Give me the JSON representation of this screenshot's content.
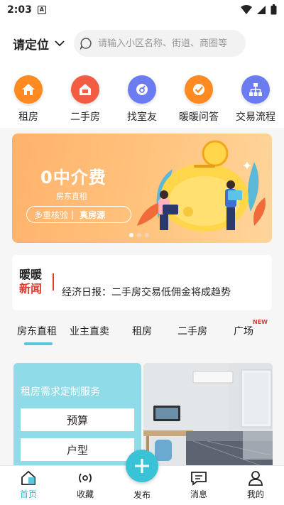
{
  "status_bar": {
    "time": "2:03",
    "a_label": "A"
  },
  "header": {
    "location_label": "请定位",
    "search_placeholder": "请输入小区名称、街道、商圈等"
  },
  "categories": [
    {
      "label": "租房",
      "icon": "house-icon",
      "color": "#ff8a22"
    },
    {
      "label": "二手房",
      "icon": "second-hand-house-icon",
      "color": "#f25c42"
    },
    {
      "label": "找室友",
      "icon": "roommate-icon",
      "color": "#6a7cf0"
    },
    {
      "label": "暖暖问答",
      "icon": "check-qa-icon",
      "color": "#ff8a22"
    },
    {
      "label": "交易流程",
      "icon": "flow-chart-icon",
      "color": "#6a7cf0"
    }
  ],
  "banner": {
    "title": "0中介费",
    "subtitle": "房东直租",
    "tag_left": "多重核验",
    "tag_right": "真房源",
    "page_index": 1,
    "page_count": 3
  },
  "news": {
    "brand_line1": "暖暖",
    "brand_line2": "新闻",
    "headline": "经济日报：二手房交易低佣金将成趋势"
  },
  "tabs": [
    {
      "label": "房东直租",
      "active": true
    },
    {
      "label": "业主直卖",
      "active": false
    },
    {
      "label": "租房",
      "active": false
    },
    {
      "label": "二手房",
      "active": false
    },
    {
      "label": "广场",
      "active": false,
      "badge": "NEW"
    }
  ],
  "card_left": {
    "title": "租房需求定制服务",
    "options": [
      "预算",
      "户型"
    ]
  },
  "bottom_nav": {
    "home": "首页",
    "favorites": "收藏",
    "publish": "发布",
    "messages": "消息",
    "mine": "我的"
  },
  "colors": {
    "accent": "#3ac2d7",
    "orange": "#ff8a22",
    "red": "#e03a2d"
  }
}
